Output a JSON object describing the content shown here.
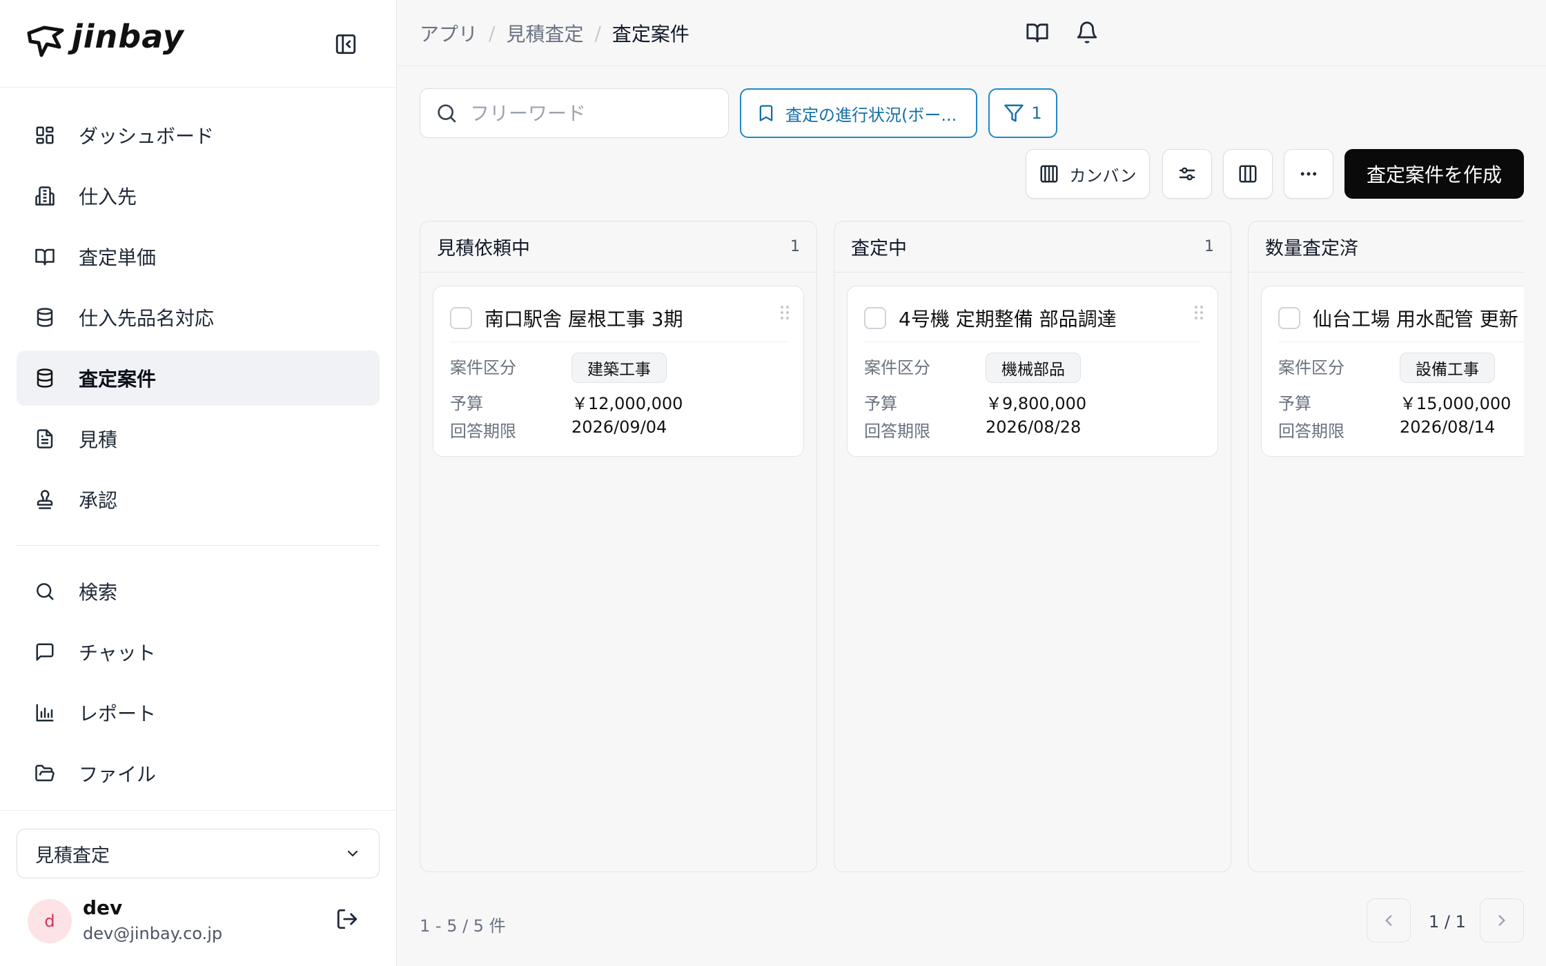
{
  "brand": {
    "name": "jinbay"
  },
  "sidebar": {
    "items": [
      {
        "label": "ダッシュボード",
        "icon": "dashboard-icon"
      },
      {
        "label": "仕入先",
        "icon": "building-icon"
      },
      {
        "label": "査定単価",
        "icon": "book-icon"
      },
      {
        "label": "仕入先品名対応",
        "icon": "database-icon"
      },
      {
        "label": "査定案件",
        "icon": "database-icon",
        "active": true
      },
      {
        "label": "見積",
        "icon": "document-icon"
      },
      {
        "label": "承認",
        "icon": "stamp-icon"
      }
    ],
    "items2": [
      {
        "label": "検索",
        "icon": "search-icon"
      },
      {
        "label": "チャット",
        "icon": "chat-icon"
      },
      {
        "label": "レポート",
        "icon": "bar-chart-icon"
      },
      {
        "label": "ファイル",
        "icon": "folder-icon"
      }
    ],
    "app_select": "見積査定",
    "user": {
      "initial": "d",
      "name": "dev",
      "email": "dev@jinbay.co.jp"
    }
  },
  "breadcrumb": {
    "items": [
      "アプリ",
      "見積査定"
    ],
    "current": "査定案件"
  },
  "toolbar": {
    "search_placeholder": "フリーワード",
    "saved_view": "査定の進行状況(ボー...",
    "filter_count": "1",
    "view_label": "カンバン",
    "create_label": "査定案件を作成"
  },
  "board": {
    "field_labels": {
      "category": "案件区分",
      "budget": "予算",
      "deadline": "回答期限"
    },
    "columns": [
      {
        "title": "見積依頼中",
        "count": "1",
        "card": {
          "title": "南口駅舎 屋根工事 3期",
          "category": "建築工事",
          "budget": "￥12,000,000",
          "deadline": "2026/09/04"
        }
      },
      {
        "title": "査定中",
        "count": "1",
        "card": {
          "title": "4号機 定期整備 部品調達",
          "category": "機械部品",
          "budget": "￥9,800,000",
          "deadline": "2026/08/28"
        }
      },
      {
        "title": "数量査定済",
        "count": "",
        "card": {
          "title": "仙台工場 用水配管 更新",
          "category": "設備工事",
          "budget": "￥15,000,000",
          "deadline": "2026/08/14"
        }
      }
    ]
  },
  "footer": {
    "count_text": "1 - 5 / 5 件",
    "page_text": "1 / 1"
  }
}
